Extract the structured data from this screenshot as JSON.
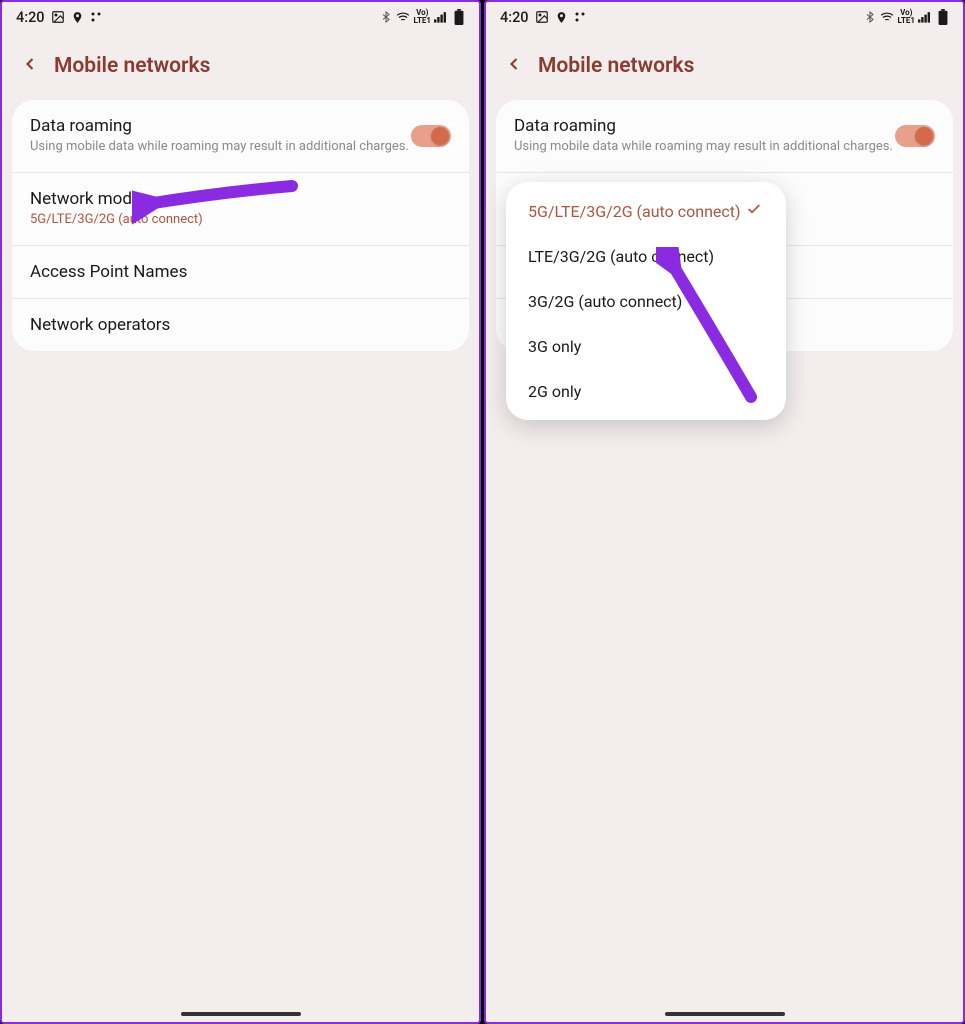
{
  "status": {
    "time": "4:20",
    "lte_label": "Vo\nLTE1"
  },
  "header": {
    "title": "Mobile networks"
  },
  "rows": {
    "roaming": {
      "label": "Data roaming",
      "sub": "Using mobile data while roaming may result in additional charges."
    },
    "netmode": {
      "label": "Network mode",
      "value": "5G/LTE/3G/2G (auto connect)"
    },
    "apn": {
      "label": "Access Point Names"
    },
    "operators": {
      "label": "Network operators"
    }
  },
  "popup": {
    "options": [
      "5G/LTE/3G/2G (auto connect)",
      "LTE/3G/2G (auto connect)",
      "3G/2G (auto connect)",
      "3G only",
      "2G only"
    ]
  }
}
